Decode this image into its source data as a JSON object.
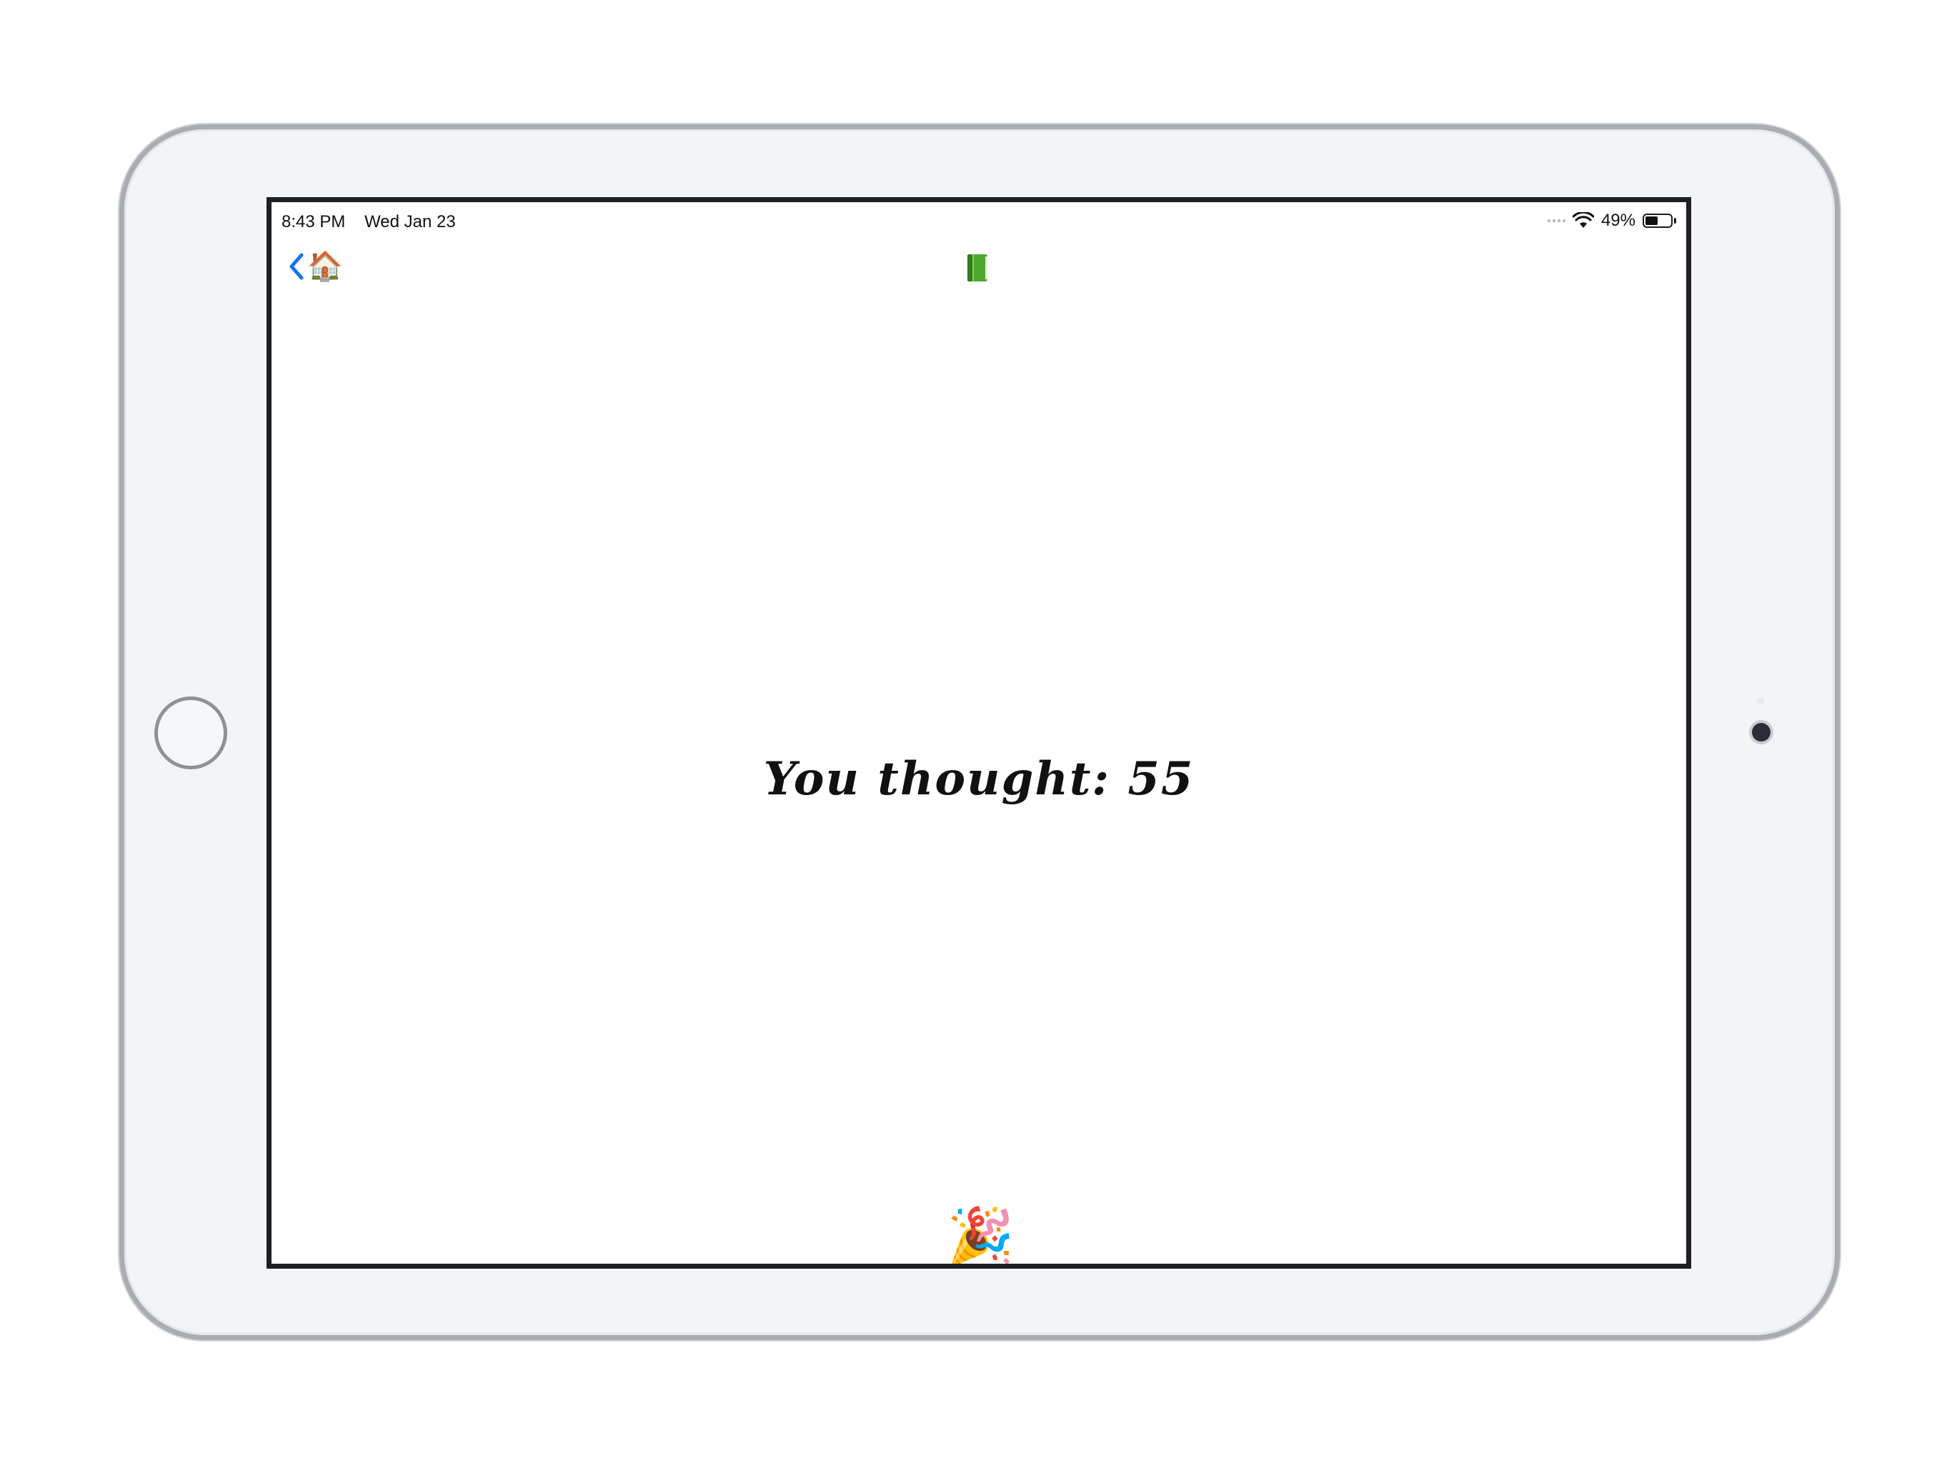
{
  "status_bar": {
    "time": "8:43 PM",
    "date": "Wed Jan 23",
    "battery_percent_label": "49%",
    "battery_level": 0.49
  },
  "nav": {
    "back_icon": "chevron-left-icon",
    "home_emoji": "🏠",
    "title_icon": "green-book-icon",
    "accent_color": "#1a73e8"
  },
  "main": {
    "result_text": "You thought: 55"
  },
  "footer": {
    "celebration_emoji": "🎉"
  }
}
